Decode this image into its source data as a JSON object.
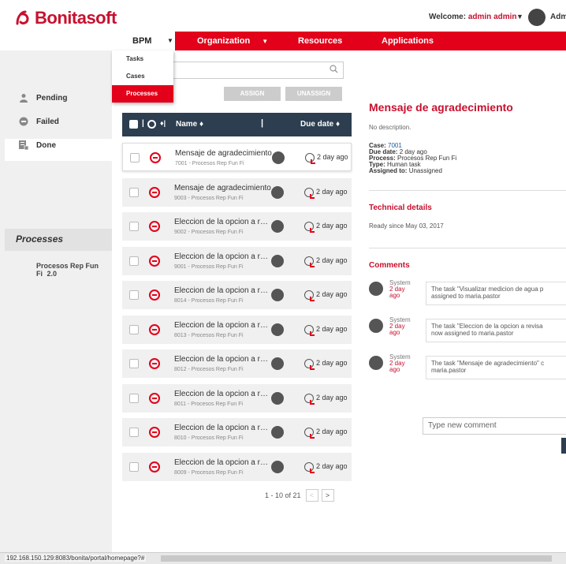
{
  "brand": {
    "name": "Bonitasoft",
    "accent": "#e2001a",
    "dark": "#2c3e50"
  },
  "header": {
    "welcome_prefix": "Welcome:",
    "user": "admin admin",
    "admin_cut": "Admi"
  },
  "nav": {
    "bpm": "BPM",
    "organization": "Organization",
    "resources": "Resources",
    "applications": "Applications"
  },
  "bpm_menu": {
    "tasks": "Tasks",
    "cases": "Cases",
    "processes": "Processes"
  },
  "sidebar": {
    "pending": "Pending",
    "failed": "Failed",
    "done": "Done",
    "processes_heading": "Processes",
    "process_item": "Procesos Rep Fun Fi",
    "process_version": "2.0"
  },
  "toolbar": {
    "assign": "ASSIGN",
    "unassign": "UNASSIGN"
  },
  "table": {
    "col_name": "Name ♦",
    "col_due": "Due date ♦",
    "rows": [
      {
        "name": "Mensaje de agradecimiento",
        "sub": "7001 - Procesos Rep Fun Fi",
        "due": "2 day ago"
      },
      {
        "name": "Mensaje de agradecimiento",
        "sub": "9003 - Procesos Rep Fun Fi",
        "due": "2 day ago"
      },
      {
        "name": "Eleccion de la opcion a revisar",
        "sub": "9002 - Procesos Rep Fun Fi",
        "due": "2 day ago"
      },
      {
        "name": "Eleccion de la opcion a revisar",
        "sub": "9001 - Procesos Rep Fun Fi",
        "due": "2 day ago"
      },
      {
        "name": "Eleccion de la opcion a revisar",
        "sub": "8014 - Procesos Rep Fun Fi",
        "due": "2 day ago"
      },
      {
        "name": "Eleccion de la opcion a revisar",
        "sub": "8013 - Procesos Rep Fun Fi",
        "due": "2 day ago"
      },
      {
        "name": "Eleccion de la opcion a revisar",
        "sub": "8012 - Procesos Rep Fun Fi",
        "due": "2 day ago"
      },
      {
        "name": "Eleccion de la opcion a revisar",
        "sub": "8011 - Procesos Rep Fun Fi",
        "due": "2 day ago"
      },
      {
        "name": "Eleccion de la opcion a revisar",
        "sub": "8010 - Procesos Rep Fun Fi",
        "due": "2 day ago"
      },
      {
        "name": "Eleccion de la opcion a revisar",
        "sub": "8009 - Procesos Rep Fun Fi",
        "due": "2 day ago"
      }
    ],
    "pager": "1 - 10 of 21"
  },
  "detail": {
    "title": "Mensaje de agradecimiento",
    "description": "No description.",
    "case_label": "Case:",
    "case_value": "7001",
    "due_label": "Due date:",
    "due_value": "2 day ago",
    "process_label": "Process:",
    "process_value": "Procesos Rep Fun Fi",
    "type_label": "Type:",
    "type_value": "Human task",
    "assigned_label": "Assigned to:",
    "assigned_value": "Unassigned",
    "technical_heading": "Technical details",
    "ready_since": "Ready since May 03, 2017",
    "comments_heading": "Comments",
    "comments": [
      {
        "who": "System",
        "when": "2 day ago",
        "text": "The task \"Visualizar medicion de agua p\nassigned to maria.pastor"
      },
      {
        "who": "System",
        "when": "2 day ago",
        "text": "The task \"Eleccion de la opcion a revisa\nnow assigned to maria.pastor"
      },
      {
        "who": "System",
        "when": "2 day ago",
        "text": "The task \"Mensaje de agradecimiento\" c\nmaria.pastor"
      }
    ],
    "new_comment_placeholder": "Type new comment"
  },
  "status": {
    "url": "192.168.150.129:8083/bonita/portal/homepage?#"
  }
}
